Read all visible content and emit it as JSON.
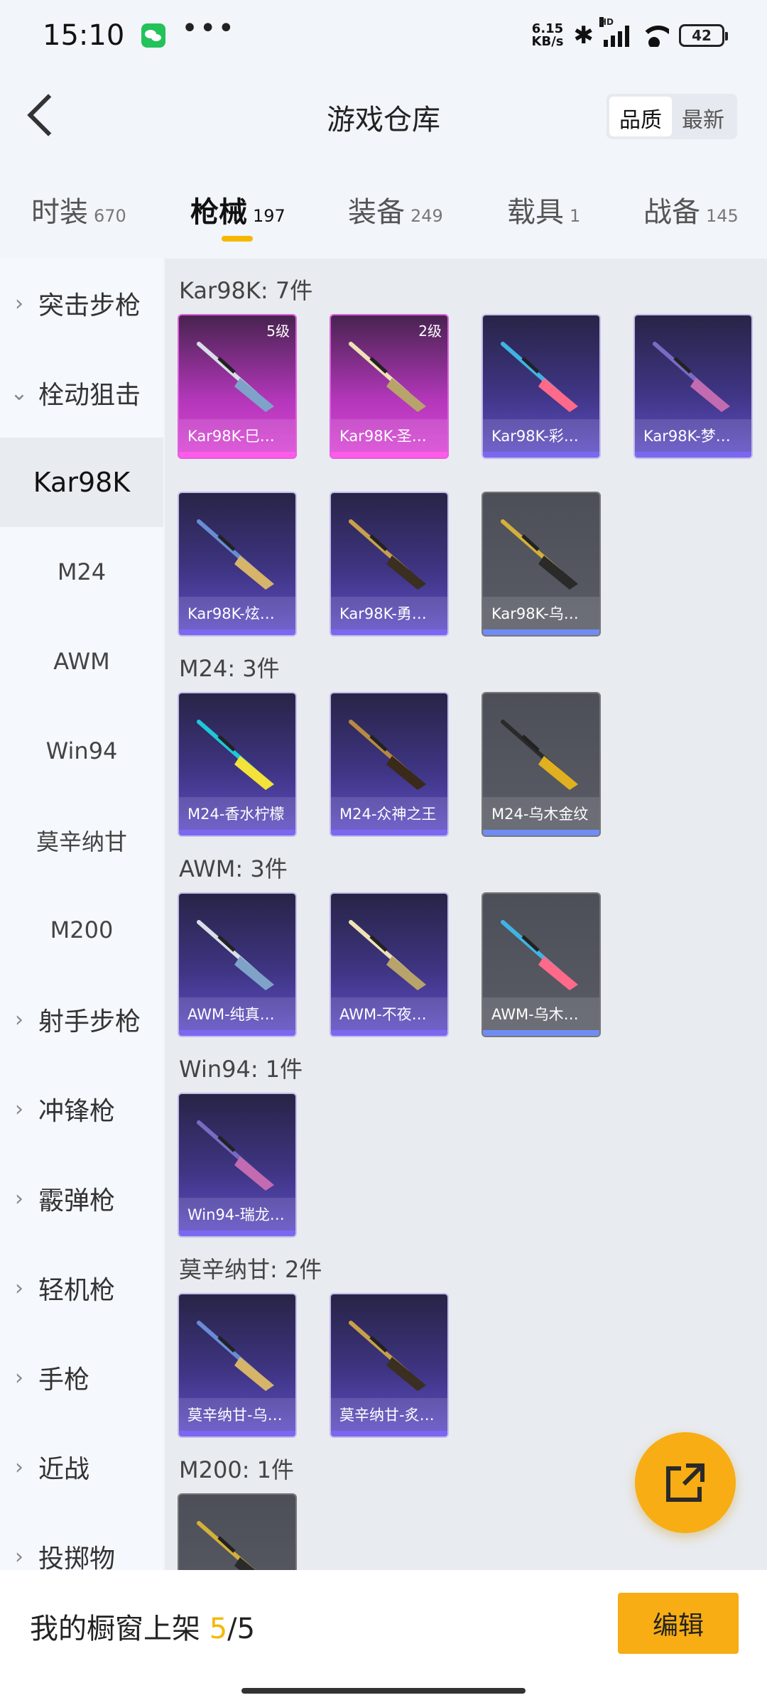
{
  "status_bar": {
    "time": "15:10",
    "dots": "•••",
    "net_speed_value": "6.15",
    "net_speed_unit": "KB/s",
    "battery": "42"
  },
  "header": {
    "title": "游戏仓库",
    "sort_options": [
      "品质",
      "最新"
    ]
  },
  "tabs": [
    {
      "label": "时装",
      "count": "670"
    },
    {
      "label": "枪械",
      "count": "197"
    },
    {
      "label": "装备",
      "count": "249"
    },
    {
      "label": "载具",
      "count": "1"
    },
    {
      "label": "战备",
      "count": "145"
    }
  ],
  "sidebar": {
    "items": [
      {
        "label": "突击步枪",
        "expandable": true
      },
      {
        "label": "栓动狙击",
        "expandable": true,
        "expanded": true
      },
      {
        "label": "Kar98K",
        "selected": true
      },
      {
        "label": "M24"
      },
      {
        "label": "AWM"
      },
      {
        "label": "Win94"
      },
      {
        "label": "莫辛纳甘"
      },
      {
        "label": "M200"
      },
      {
        "label": "射手步枪",
        "expandable": true
      },
      {
        "label": "冲锋枪",
        "expandable": true
      },
      {
        "label": "霰弹枪",
        "expandable": true
      },
      {
        "label": "轻机枪",
        "expandable": true
      },
      {
        "label": "手枪",
        "expandable": true
      },
      {
        "label": "近战",
        "expandable": true
      },
      {
        "label": "投掷物",
        "expandable": true
      }
    ]
  },
  "groups": [
    {
      "title": "Kar98K: 7件",
      "items": [
        {
          "name": "Kar98K-巳…",
          "level": "5级",
          "rarity": "pink"
        },
        {
          "name": "Kar98K-圣…",
          "level": "2级",
          "rarity": "pink"
        },
        {
          "name": "Kar98K-彩…",
          "rarity": "purple"
        },
        {
          "name": "Kar98K-梦…",
          "rarity": "purple"
        },
        {
          "name": "Kar98K-炫…",
          "rarity": "purple"
        },
        {
          "name": "Kar98K-勇…",
          "rarity": "purple"
        },
        {
          "name": "Kar98K-乌…",
          "rarity": "gray"
        }
      ]
    },
    {
      "title": "M24: 3件",
      "items": [
        {
          "name": "M24-香水柠檬",
          "rarity": "purple"
        },
        {
          "name": "M24-众神之王",
          "rarity": "purple"
        },
        {
          "name": "M24-乌木金纹",
          "rarity": "gray"
        }
      ]
    },
    {
      "title": "AWM: 3件",
      "items": [
        {
          "name": "AWM-纯真…",
          "rarity": "purple"
        },
        {
          "name": "AWM-不夜…",
          "rarity": "purple"
        },
        {
          "name": "AWM-乌木…",
          "rarity": "gray"
        }
      ]
    },
    {
      "title": "Win94: 1件",
      "items": [
        {
          "name": "Win94-瑞龙…",
          "rarity": "purple"
        }
      ]
    },
    {
      "title": "莫辛纳甘: 2件",
      "items": [
        {
          "name": "莫辛纳甘-乌…",
          "rarity": "purple"
        },
        {
          "name": "莫辛纳甘-炙…",
          "rarity": "purple"
        }
      ]
    },
    {
      "title": "M200: 1件",
      "items": [
        {
          "name": "",
          "rarity": "gray"
        }
      ]
    }
  ],
  "bottom": {
    "shelf_label": "我的橱窗上架",
    "shelf_current": "5",
    "shelf_total": "/5",
    "edit_label": "编辑"
  },
  "colors": {
    "accent": "#f7ad13",
    "tab_underline": "#f5b800",
    "rarity_pink": "#dc46d6",
    "rarity_purple": "#5f4fc8",
    "rarity_gray": "#595c66"
  }
}
